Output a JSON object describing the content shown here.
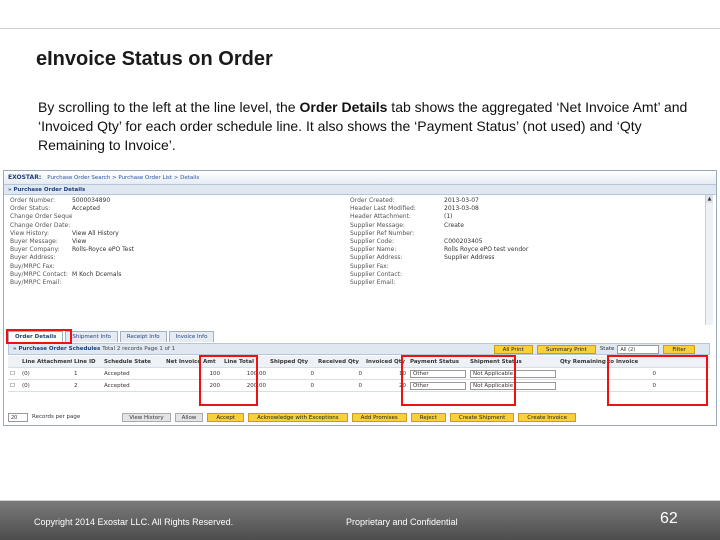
{
  "slide": {
    "title": "eInvoice Status on Order",
    "intro_1": "By scrolling to the left at the line level, the ",
    "intro_bold": "Order Details",
    "intro_2": " tab shows the aggregated ‘Net Invoice Amt’ and ‘Invoiced Qty’ for each order schedule line.  It also shows the ‘Payment Status’ (not used) and ‘Qty Remaining to Invoice’."
  },
  "screenshot": {
    "brand": "EXOSTAR:",
    "breadcrumb": "Purchase Order Search > Purchase Order List > Details",
    "po_details_title": "» Purchase Order Details",
    "left_fields": [
      {
        "label": "Order Number:",
        "value": "5000034890"
      },
      {
        "label": "Order Status:",
        "value": "Accepted"
      },
      {
        "label": "Change Order Sequence:",
        "value": ""
      },
      {
        "label": "Change Order Date:",
        "value": ""
      },
      {
        "label": "View History:",
        "value": "View All History"
      },
      {
        "label": "Buyer Message:",
        "value": "View"
      },
      {
        "label": "Buyer Company:",
        "value": "Rolls-Royce ePO Test"
      },
      {
        "label": "Buyer Address:",
        "value": ""
      },
      {
        "label": "Buy/MRPC Fax:",
        "value": ""
      },
      {
        "label": "Buy/MRPC Contact:",
        "value": "M Koch Dcemals"
      },
      {
        "label": "Buy/MRPC Email:",
        "value": ""
      }
    ],
    "right_fields": [
      {
        "label": "Order Created:",
        "value": "2013-03-07"
      },
      {
        "label": "Header Last Modified:",
        "value": "2013-03-08"
      },
      {
        "label": "Header Attachment:",
        "value": "(1)"
      },
      {
        "label": "Supplier Message:",
        "value": "Create"
      },
      {
        "label": "Supplier Ref Number:",
        "value": ""
      },
      {
        "label": "Supplier Code:",
        "value": "C000203405"
      },
      {
        "label": "Supplier Name:",
        "value": "Rolls Royce ePO test vendor"
      },
      {
        "label": "Supplier Address:",
        "value": "Supplier Address"
      },
      {
        "label": "Supplier Fax:",
        "value": ""
      },
      {
        "label": "Supplier Contact:",
        "value": ""
      },
      {
        "label": "Supplier Email:",
        "value": ""
      }
    ],
    "tabs": [
      "Order Details",
      "Shipment Info",
      "Receipt Info",
      "Invoice Info"
    ],
    "schedules_title": "» Purchase Order Schedules",
    "schedules_meta": "Total 2 records Page 1 of 1",
    "btn_fill_print": "All Print",
    "btn_summary_print": "Summary Print",
    "state_label": "State",
    "state_value": "All (2)",
    "btn_filter": "Filter",
    "columns": [
      "",
      "Line Attachment",
      "Line ID",
      "Schedule State",
      "Net Invoice Amt",
      "Line Total",
      "Shipped Qty",
      "Received Qty",
      "Invoiced Qty",
      "Payment Status",
      "Shipment Status",
      "Qty Remaining to Invoice"
    ],
    "rows": [
      {
        "attach": "(0)",
        "line": "1",
        "state": "Accepted",
        "net": "100",
        "total": "100.00",
        "shipped": "0",
        "received": "0",
        "invoiced": "10",
        "payment": "Other",
        "shipment": "Not Applicable",
        "remaining": "0"
      },
      {
        "attach": "(0)",
        "line": "2",
        "state": "Accepted",
        "net": "200",
        "total": "200.00",
        "shipped": "0",
        "received": "0",
        "invoiced": "20",
        "payment": "Other",
        "shipment": "Not Applicable",
        "remaining": "0"
      }
    ],
    "page_size": "20",
    "pager_text": "Records per page",
    "bottom_buttons": [
      "View History",
      "Allow",
      "Accept",
      "Acknowledge with Exceptions",
      "Add Promises",
      "Reject",
      "Create Shipment",
      "Create Invoice"
    ]
  },
  "footer": {
    "copyright": "Copyright 2014 Exostar LLC. All Rights Reserved.",
    "proprietary": "Proprietary and Confidential",
    "page_number": "62"
  },
  "colors": {
    "highlight": "#ee1111",
    "accent_yellow": "#f6d13a",
    "brand_blue": "#1e3f7a",
    "footer_gray": "#5a5a5a"
  }
}
